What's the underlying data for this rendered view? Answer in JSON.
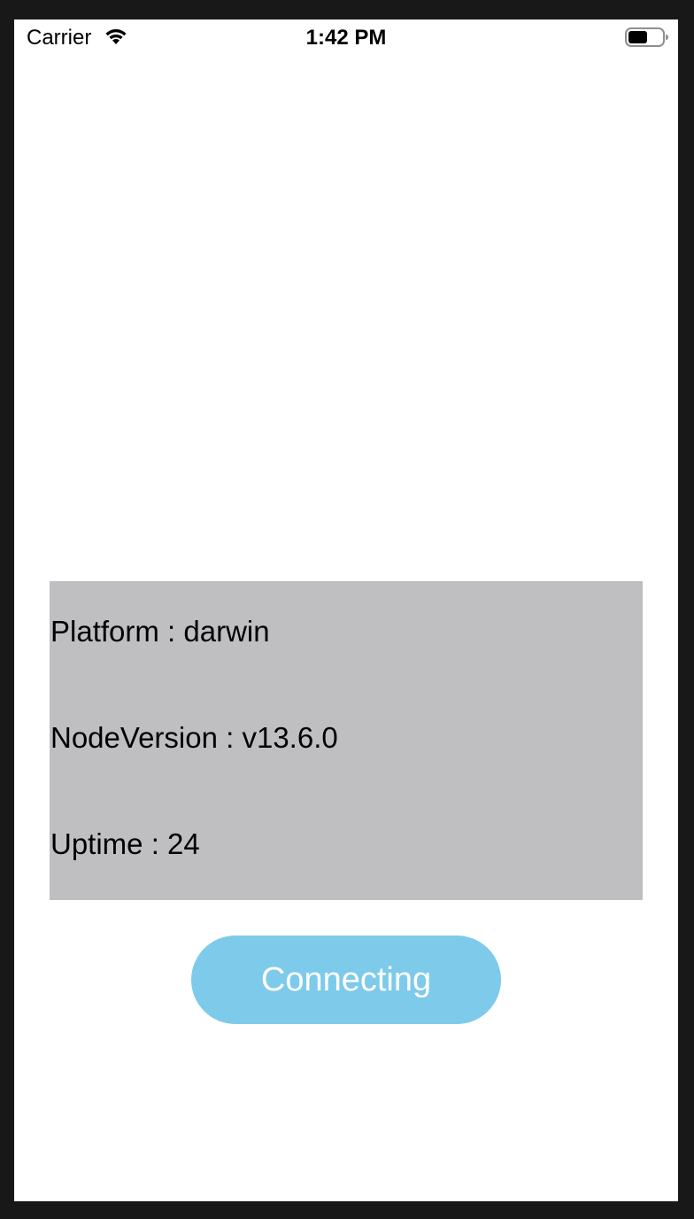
{
  "status_bar": {
    "carrier": "Carrier",
    "time": "1:42 PM",
    "icons": [
      "wifi-icon",
      "battery-icon"
    ]
  },
  "info": {
    "platform": "Platform : darwin",
    "node_version": "NodeVersion : v13.6.0",
    "uptime": "Uptime : 24"
  },
  "action": {
    "button_label": "Connecting"
  },
  "colors": {
    "panel_background": "#bfbfc1",
    "button_background": "#7ecaea",
    "button_text": "#ffffff"
  }
}
